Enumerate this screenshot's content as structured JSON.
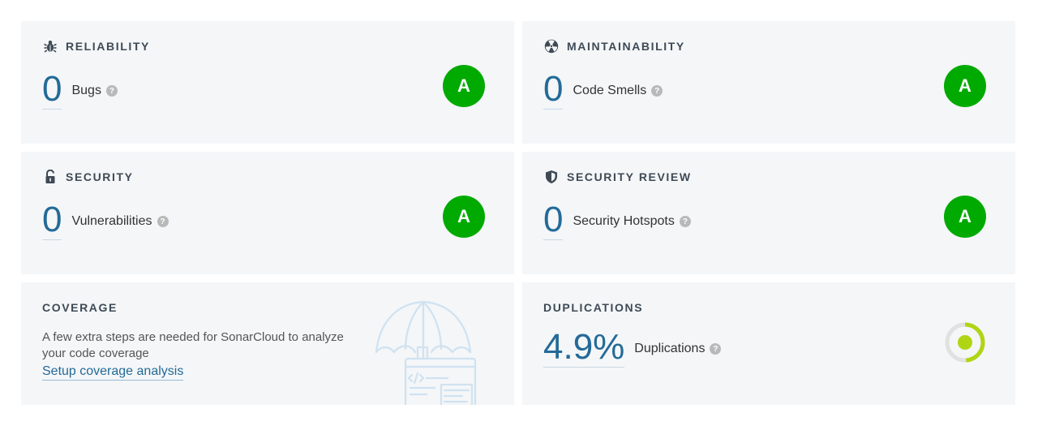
{
  "reliability": {
    "title": "RELIABILITY",
    "icon": "bug-icon",
    "value": "0",
    "label": "Bugs",
    "help": "?",
    "grade": "A"
  },
  "maintainability": {
    "title": "MAINTAINABILITY",
    "icon": "radiation-icon",
    "value": "0",
    "label": "Code Smells",
    "help": "?",
    "grade": "A"
  },
  "security": {
    "title": "SECURITY",
    "icon": "lock-open-icon",
    "value": "0",
    "label": "Vulnerabilities",
    "help": "?",
    "grade": "A"
  },
  "security_review": {
    "title": "SECURITY REVIEW",
    "icon": "shield-icon",
    "value": "0",
    "label": "Security Hotspots",
    "help": "?",
    "grade": "A"
  },
  "coverage": {
    "title": "COVERAGE",
    "message": "A few extra steps are needed for SonarCloud to analyze your code coverage",
    "link": "Setup coverage analysis",
    "illustration": "umbrella-code-illustration"
  },
  "duplications": {
    "title": "DUPLICATIONS",
    "value": "4.9%",
    "label": "Duplications",
    "help": "?",
    "ratio": 0.049
  },
  "colors": {
    "grade_a": "#00aa00",
    "value_blue": "#236a97",
    "card_bg": "#f4f6f8",
    "donut_green": "#b0d513",
    "donut_track": "#e1e1e1"
  }
}
